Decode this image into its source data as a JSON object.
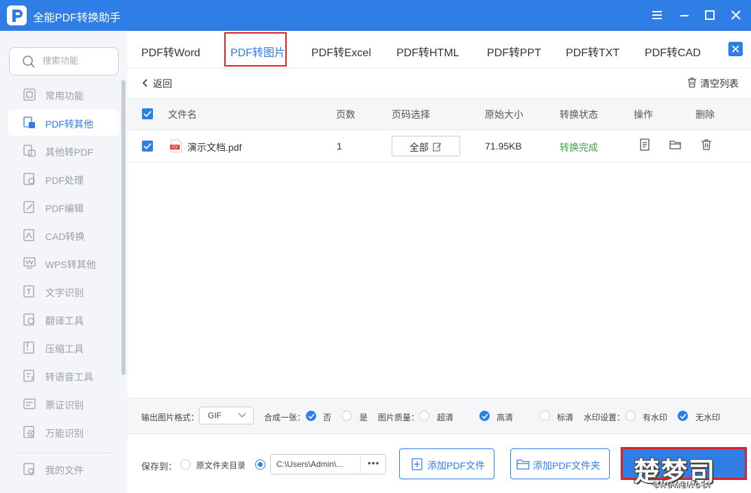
{
  "app": {
    "title": "全能PDF转换助手"
  },
  "sidebar": {
    "search_placeholder": "搜索功能",
    "items": [
      {
        "label": "常用功能",
        "icon": "common-functions-icon"
      },
      {
        "label": "PDF转其他",
        "icon": "pdf-to-other-icon",
        "active": true
      },
      {
        "label": "其他转PDF",
        "icon": "other-to-pdf-icon"
      },
      {
        "label": "PDF处理",
        "icon": "pdf-process-icon"
      },
      {
        "label": "PDF编辑",
        "icon": "pdf-edit-icon"
      },
      {
        "label": "CAD转换",
        "icon": "cad-convert-icon"
      },
      {
        "label": "WPS转其他",
        "icon": "wps-convert-icon"
      },
      {
        "label": "文字识别",
        "icon": "ocr-icon"
      },
      {
        "label": "翻译工具",
        "icon": "translate-icon"
      },
      {
        "label": "压缩工具",
        "icon": "compress-icon"
      },
      {
        "label": "转语音工具",
        "icon": "text-to-speech-icon"
      },
      {
        "label": "票证识别",
        "icon": "ticket-recognition-icon"
      },
      {
        "label": "万能识别",
        "icon": "universal-recognition-icon"
      }
    ],
    "my_files": "我的文件"
  },
  "tabs": [
    {
      "label": "PDF转Word"
    },
    {
      "label": "PDF转图片",
      "active": true
    },
    {
      "label": "PDF转Excel"
    },
    {
      "label": "PDF转HTML"
    },
    {
      "label": "PDF转PPT"
    },
    {
      "label": "PDF转TXT"
    },
    {
      "label": "PDF转CAD"
    }
  ],
  "toolbar": {
    "back": "返回",
    "clear_list": "清空列表"
  },
  "table": {
    "headers": {
      "filename": "文件名",
      "pages": "页数",
      "page_select": "页码选择",
      "size": "原始大小",
      "status": "转换状态",
      "ops": "操作",
      "delete": "删除"
    },
    "rows": [
      {
        "filename": "演示文档.pdf",
        "pages": "1",
        "page_select": "全部",
        "size": "71.95KB",
        "status": "转换完成",
        "file_badge": "PDF"
      }
    ]
  },
  "settings": {
    "format_label": "输出图片格式：",
    "format_value": "GIF",
    "merge_label": "合成一张：",
    "merge_no": "否",
    "merge_yes": "是",
    "quality_label": "图片质量：",
    "quality_ultra": "超清",
    "quality_high": "高清",
    "quality_standard": "标清",
    "watermark_label": "水印设置：",
    "watermark_yes": "有水印",
    "watermark_no": "无水印"
  },
  "bottom": {
    "save_to": "保存到：",
    "source_dir": "原文件夹目录",
    "path": "C:\\Users\\Admin\\...",
    "dots": "•••",
    "add_file": "添加PDF文件",
    "add_folder": "添加PDF文件夹"
  },
  "watermark": {
    "main": "楚梦司",
    "sub": "CHUMENGSI"
  },
  "colors": {
    "accent": "#2f7ee6",
    "success": "#3aa64a",
    "highlight": "#e02020"
  }
}
